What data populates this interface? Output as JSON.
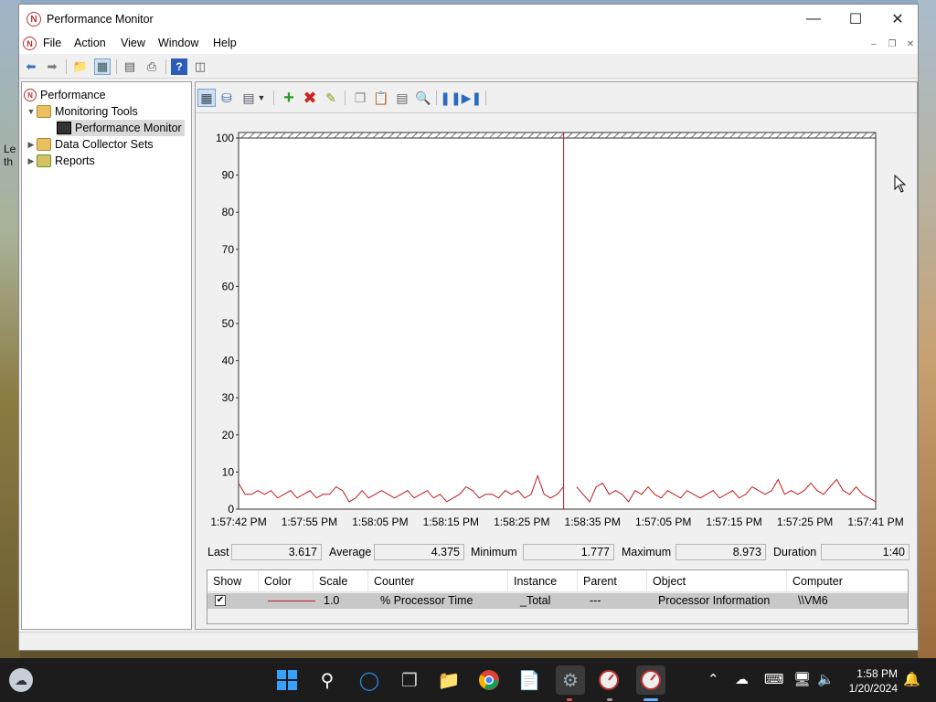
{
  "window": {
    "title": "Performance Monitor"
  },
  "menu": [
    "File",
    "Action",
    "View",
    "Window",
    "Help"
  ],
  "tree": {
    "root": "Performance",
    "items": [
      {
        "label": "Monitoring Tools",
        "expanded": true
      },
      {
        "label": "Performance Monitor",
        "selected": true
      },
      {
        "label": "Data Collector Sets",
        "expanded": false
      },
      {
        "label": "Reports",
        "expanded": false
      }
    ]
  },
  "graph": {
    "line_color": "#c0181e",
    "y_ticks": [
      "100",
      "90",
      "80",
      "70",
      "60",
      "50",
      "40",
      "30",
      "20",
      "10",
      "0"
    ],
    "x_ticks": [
      "1:57:42 PM",
      "1:57:55 PM",
      "1:58:05 PM",
      "1:58:15 PM",
      "1:58:25 PM",
      "1:58:35 PM",
      "1:57:05 PM",
      "1:57:15 PM",
      "1:57:25 PM",
      "1:57:41 PM"
    ]
  },
  "chart_data": {
    "type": "line",
    "ylim": [
      0,
      100
    ],
    "series": [
      {
        "values": [
          7,
          4,
          4,
          5,
          4,
          5,
          3,
          4,
          5,
          3,
          4,
          5,
          3,
          4,
          4,
          6,
          5,
          2,
          3,
          5,
          3,
          4,
          5,
          4,
          3,
          4,
          5,
          3,
          4,
          5,
          3,
          4,
          2,
          3,
          4,
          6,
          5,
          3,
          4,
          4,
          3,
          5,
          4,
          5,
          3,
          4,
          9,
          4,
          3,
          4,
          6,
          5,
          6,
          4,
          2,
          6,
          7,
          4,
          5,
          4,
          2,
          5,
          4,
          6,
          4,
          3,
          5,
          4,
          3,
          5,
          4,
          3,
          4,
          5,
          3,
          4,
          5,
          3,
          4,
          6,
          5,
          4,
          5,
          8,
          4,
          5,
          4,
          5,
          7,
          5,
          4,
          6,
          8,
          5,
          4,
          6,
          4,
          3,
          2
        ]
      }
    ],
    "current_index": 50,
    "gap_after_index": 51
  },
  "stats": {
    "last_label": "Last",
    "last_value": "3.617",
    "average_label": "Average",
    "average_value": "4.375",
    "minimum_label": "Minimum",
    "minimum_value": "1.777",
    "maximum_label": "Maximum",
    "maximum_value": "8.973",
    "duration_label": "Duration",
    "duration_value": "1:40"
  },
  "legend": {
    "columns": [
      "Show",
      "Color",
      "Scale",
      "Counter",
      "Instance",
      "Parent",
      "Object",
      "Computer"
    ],
    "row": {
      "show": "✔",
      "scale": "1.0",
      "counter": "% Processor Time",
      "instance": "_Total",
      "parent": "---",
      "object": "Processor Information",
      "computer": "\\\\VM6"
    }
  },
  "taskbar": {
    "time": "1:58 PM",
    "date": "1/20/2024"
  },
  "desktop_text": "Le\nth"
}
